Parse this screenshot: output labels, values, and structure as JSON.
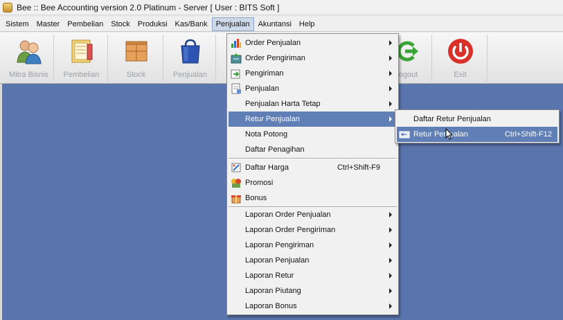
{
  "window": {
    "title": "Bee :: Bee Accounting version 2.0 Platinum - Server  [ User : BITS Soft ]"
  },
  "menubar": {
    "items": [
      {
        "label": "Sistem"
      },
      {
        "label": "Master"
      },
      {
        "label": "Pembelian"
      },
      {
        "label": "Stock"
      },
      {
        "label": "Produksi"
      },
      {
        "label": "Kas/Bank"
      },
      {
        "label": "Penjualan",
        "active": true
      },
      {
        "label": "Akuntansi"
      },
      {
        "label": "Help"
      }
    ]
  },
  "toolbar": {
    "buttons": [
      {
        "label": "Mitra Bisnis",
        "icon": "users-icon"
      },
      {
        "label": "Pembelian",
        "icon": "notebook-icon"
      },
      {
        "label": "Stock",
        "icon": "box-icon"
      },
      {
        "label": "Penjualan",
        "icon": "shopping-bag-icon"
      },
      {
        "label": "Logout",
        "icon": "logout-icon"
      },
      {
        "label": "Exit",
        "icon": "power-icon"
      }
    ]
  },
  "penjualan_menu": {
    "items": [
      {
        "label": "Order Penjualan",
        "icon": "chart-icon",
        "submenu": true
      },
      {
        "label": "Order Pengiriman",
        "icon": "delivery-order-icon",
        "submenu": true
      },
      {
        "label": "Pengiriman",
        "icon": "shipping-icon",
        "submenu": true
      },
      {
        "label": "Penjualan",
        "icon": "invoice-icon",
        "submenu": true
      },
      {
        "label": "Penjualan Harta Tetap",
        "icon": "",
        "submenu": true
      },
      {
        "label": "Retur Penjualan",
        "icon": "",
        "submenu": true,
        "highlighted": true
      },
      {
        "label": "Nota Potong",
        "icon": ""
      },
      {
        "label": "Daftar Penagihan",
        "icon": ""
      },
      {
        "label": "Daftar Harga",
        "icon": "price-list-icon",
        "shortcut": "Ctrl+Shift-F9"
      },
      {
        "label": "Promosi",
        "icon": "promo-icon"
      },
      {
        "label": "Bonus",
        "icon": "bonus-icon"
      },
      {
        "label": "Laporan Order Penjualan",
        "icon": "",
        "submenu": true
      },
      {
        "label": "Laporan Order Pengiriman",
        "icon": "",
        "submenu": true
      },
      {
        "label": "Laporan Pengiriman",
        "icon": "",
        "submenu": true
      },
      {
        "label": "Laporan Penjualan",
        "icon": "",
        "submenu": true
      },
      {
        "label": "Laporan Retur",
        "icon": "",
        "submenu": true
      },
      {
        "label": "Laporan Piutang",
        "icon": "",
        "submenu": true
      },
      {
        "label": "Laporan Bonus",
        "icon": "",
        "submenu": true
      }
    ]
  },
  "retur_submenu": {
    "items": [
      {
        "label": "Daftar Retur Penjualan",
        "icon": ""
      },
      {
        "label": "Retur Penjualan",
        "icon": "return-icon",
        "shortcut": "Ctrl+Shift-F12",
        "highlighted": true
      }
    ]
  },
  "colors": {
    "workspace": "#5a75ad",
    "highlight": "#5f7fb6",
    "menubar_active": "#cdd9e8"
  }
}
